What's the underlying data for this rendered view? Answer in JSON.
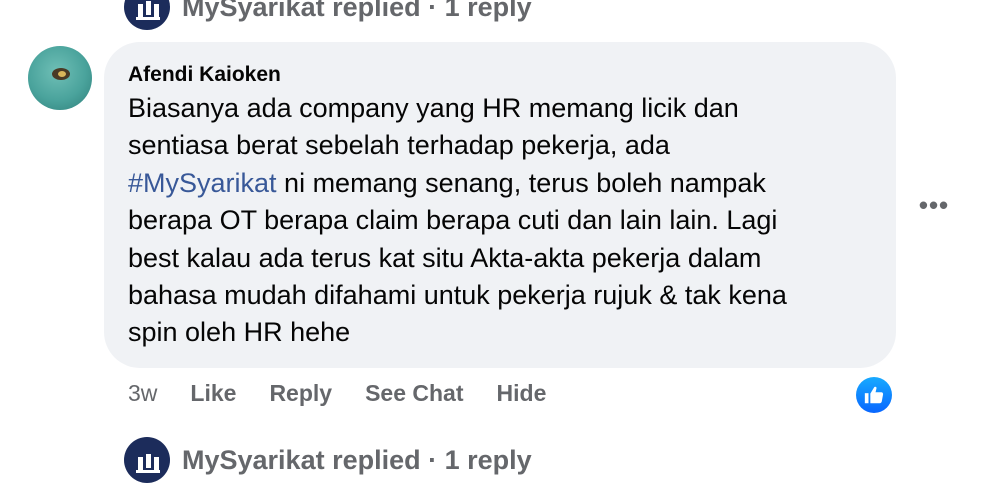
{
  "thread": {
    "top_reply": {
      "text": "MySyarikat replied · 1 reply"
    },
    "bottom_reply": {
      "text": "MySyarikat replied · 1 reply"
    }
  },
  "comment": {
    "author": "Afendi Kaioken",
    "lines": [
      {
        "text": "Biasanya ada company yang HR memang licik dan"
      },
      {
        "text": "sentiasa berat sebelah terhadap pekerja, ada"
      },
      {
        "hashtag": "#MySyarikat",
        "text": " ni memang senang, terus boleh nampak"
      },
      {
        "text": "berapa OT berapa claim berapa cuti dan lain lain. Lagi"
      },
      {
        "text": "best kalau ada terus kat situ Akta-akta pekerja dalam"
      },
      {
        "text": "bahasa mudah difahami untuk pekerja rujuk & tak kena"
      },
      {
        "text": "spin oleh HR hehe"
      }
    ],
    "more_icon": "more-horizontal-icon",
    "more_glyph": "•••",
    "timestamp": "3w",
    "actions": {
      "like": "Like",
      "reply": "Reply",
      "see_chat": "See Chat",
      "hide": "Hide"
    },
    "reaction": {
      "icon": "thumbs-up-icon",
      "color": "#0866ff"
    }
  },
  "colors": {
    "bubble": "#f0f2f5",
    "secondary_text": "#65676b",
    "hashtag": "#385898",
    "page_avatar": "#1c2c5b"
  }
}
